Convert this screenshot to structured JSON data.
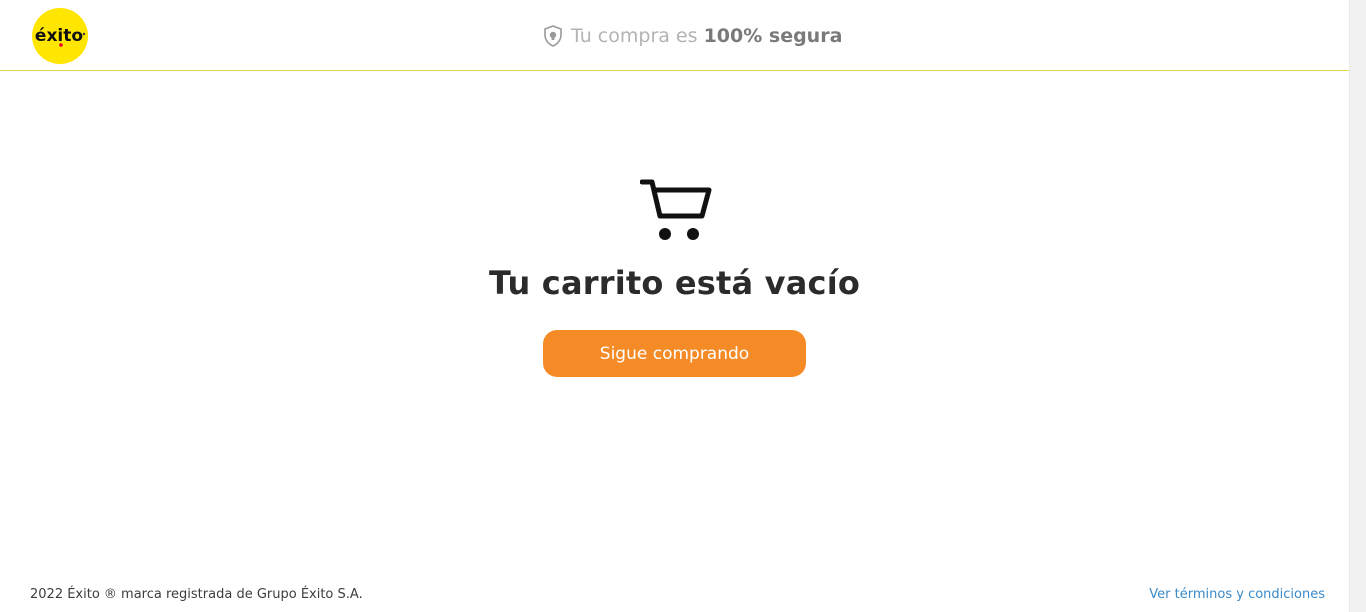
{
  "header": {
    "logo_text": "éxito",
    "secure_prefix": "Tu compra es ",
    "secure_strong": "100% segura",
    "shield_icon": "shield-icon"
  },
  "cart": {
    "icon": "shopping-cart-icon",
    "title": "Tu carrito está vacío",
    "button_label": "Sigue comprando"
  },
  "footer": {
    "copyright": "2022 Éxito ® marca registrada de Grupo Éxito S.A.",
    "terms_link": "Ver términos y condiciones"
  },
  "colors": {
    "brand_yellow": "#ffe600",
    "button_orange": "#f58b27",
    "link_blue": "#3a8ac9"
  }
}
